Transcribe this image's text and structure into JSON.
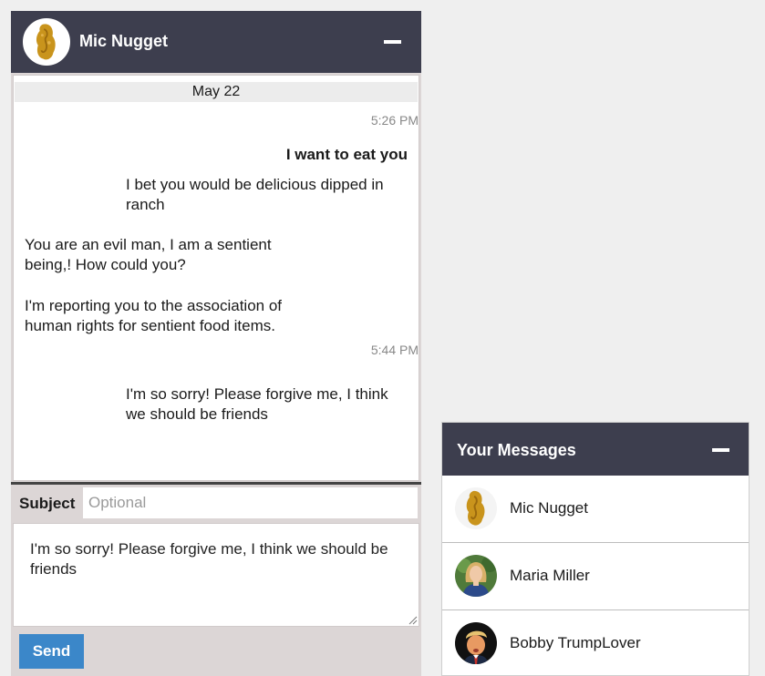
{
  "chat": {
    "avatar_icon": "chicken-nugget-avatar",
    "title": "Mic Nugget",
    "minimize_icon": "minus-icon",
    "date_separator": "May 22",
    "messages": [
      {
        "time": "5:26 PM"
      },
      {
        "text": "I want to eat you",
        "style": "bold",
        "align": "right"
      },
      {
        "text": "I bet you would be delicious dipped in ranch"
      },
      {
        "text": "You are an evil man, I am a sentient being,! How could you?"
      },
      {
        "text": "I'm reporting you to the association of human rights for sentient food items."
      },
      {
        "time": "5:44 PM"
      },
      {
        "text": "I'm so sorry! Please forgive me, I think we should be friends"
      }
    ]
  },
  "compose": {
    "subject_label": "Subject",
    "subject_placeholder": "Optional",
    "body_value": "I'm so sorry! Please forgive me, I think we should be friends",
    "send_label": "Send"
  },
  "inbox": {
    "title": "Your Messages",
    "minimize_icon": "minus-icon",
    "contacts": [
      {
        "name": "Mic Nugget",
        "avatar": "chicken-nugget-avatar"
      },
      {
        "name": "Maria Miller",
        "avatar": "woman-portrait-avatar"
      },
      {
        "name": "Bobby TrumpLover",
        "avatar": "man-portrait-avatar"
      }
    ]
  },
  "colors": {
    "header_bg": "#3d3e4e",
    "send_button": "#3b87c9",
    "panel_bg": "#dcd6d6",
    "page_bg": "#efefef"
  }
}
